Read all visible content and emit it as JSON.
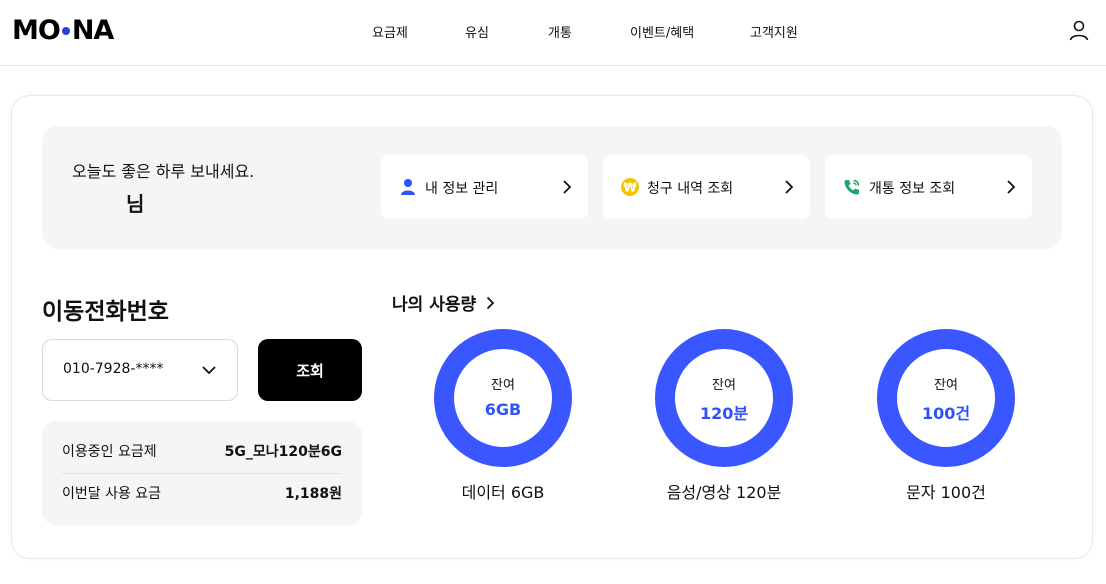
{
  "brand": {
    "logo_left": "MO",
    "logo_right": "NA",
    "accent": "#2d3fd6"
  },
  "nav": {
    "items": [
      {
        "label": "요금제"
      },
      {
        "label": "유심"
      },
      {
        "label": "개통"
      },
      {
        "label": "이벤트/혜택"
      },
      {
        "label": "고객지원"
      }
    ],
    "user_icon": "user-icon"
  },
  "greeting": {
    "text": "오늘도 좋은 하루 보내세요.",
    "name_suffix": "님"
  },
  "quick_links": [
    {
      "label": "내 정보 관리",
      "icon": "person-icon",
      "color": "#2e52ff"
    },
    {
      "label": "청구 내역 조회",
      "icon": "won-coin-icon",
      "color": "#f5c400"
    },
    {
      "label": "개통 정보 조회",
      "icon": "phone-call-icon",
      "color": "#1aa36b"
    }
  ],
  "phone": {
    "title": "이동전화번호",
    "selected_number": "010-7928-****",
    "lookup_button": "조회"
  },
  "plan": {
    "rows": [
      {
        "key": "이용중인 요금제",
        "value": "5G_모나120분6G"
      },
      {
        "key": "이번달 사용 요금",
        "value": "1,188원"
      }
    ]
  },
  "usage": {
    "title": "나의 사용량",
    "gauge_color": "#3a57ff",
    "items": [
      {
        "label": "잔여",
        "value": "6GB",
        "caption": "데이터 6GB",
        "remaining_ratio": 1.0
      },
      {
        "label": "잔여",
        "value": "120분",
        "caption": "음성/영상 120분",
        "remaining_ratio": 1.0
      },
      {
        "label": "잔여",
        "value": "100건",
        "caption": "문자 100건",
        "remaining_ratio": 1.0
      }
    ]
  }
}
